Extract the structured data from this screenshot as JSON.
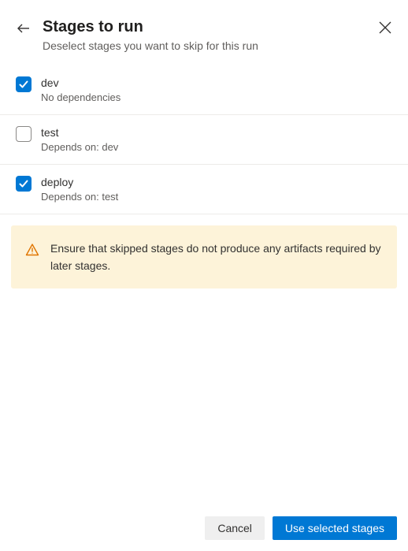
{
  "header": {
    "title": "Stages to run",
    "subtitle": "Deselect stages you want to skip for this run"
  },
  "stages": [
    {
      "name": "dev",
      "dependency": "No dependencies",
      "checked": true
    },
    {
      "name": "test",
      "dependency": "Depends on: dev",
      "checked": false
    },
    {
      "name": "deploy",
      "dependency": "Depends on: test",
      "checked": true
    }
  ],
  "warning": {
    "text": "Ensure that skipped stages do not produce any artifacts required by later stages."
  },
  "footer": {
    "cancel_label": "Cancel",
    "primary_label": "Use selected stages"
  },
  "colors": {
    "accent": "#0078d4",
    "warning_bg": "#fdf3d9",
    "warning_icon": "#e07400"
  }
}
